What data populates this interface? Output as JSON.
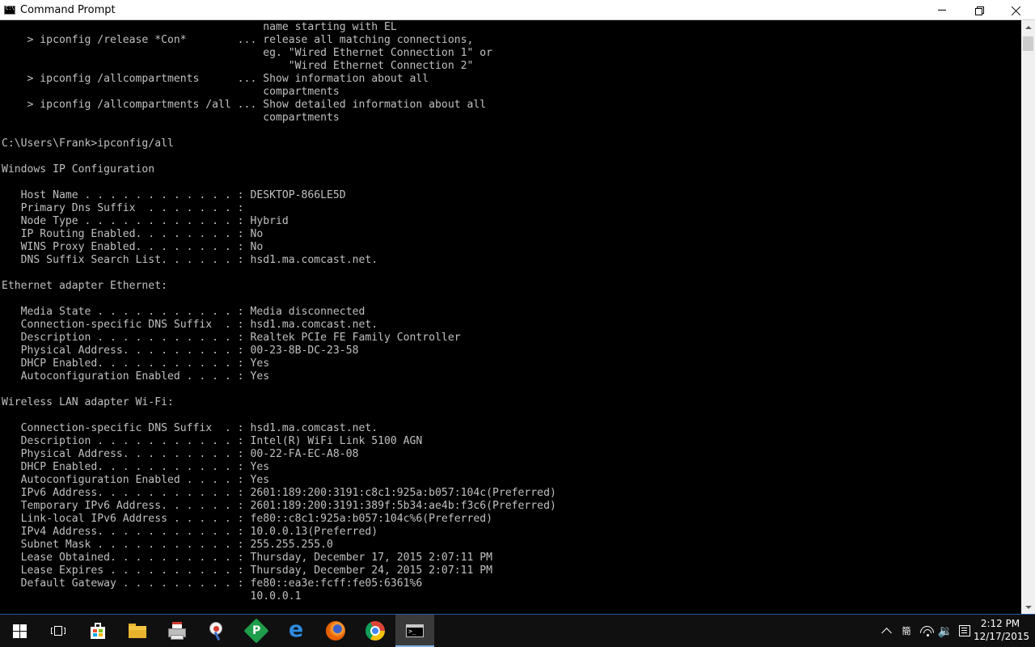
{
  "window": {
    "title": "Command Prompt",
    "minimize_icon": "minimize-icon",
    "maximize_icon": "restore-icon",
    "close_icon": "close-icon"
  },
  "console": {
    "text_color": "#c0c0c0",
    "background": "#000000",
    "lines": [
      "                                         name starting with EL",
      "    > ipconfig /release *Con*        ... release all matching connections,",
      "                                         eg. \"Wired Ethernet Connection 1\" or",
      "                                             \"Wired Ethernet Connection 2\"",
      "    > ipconfig /allcompartments      ... Show information about all",
      "                                         compartments",
      "    > ipconfig /allcompartments /all ... Show detailed information about all",
      "                                         compartments",
      "",
      "C:\\Users\\Frank>ipconfig/all",
      "",
      "Windows IP Configuration",
      "",
      "   Host Name . . . . . . . . . . . . : DESKTOP-866LE5D",
      "   Primary Dns Suffix  . . . . . . . :",
      "   Node Type . . . . . . . . . . . . : Hybrid",
      "   IP Routing Enabled. . . . . . . . : No",
      "   WINS Proxy Enabled. . . . . . . . : No",
      "   DNS Suffix Search List. . . . . . : hsd1.ma.comcast.net.",
      "",
      "Ethernet adapter Ethernet:",
      "",
      "   Media State . . . . . . . . . . . : Media disconnected",
      "   Connection-specific DNS Suffix  . : hsd1.ma.comcast.net.",
      "   Description . . . . . . . . . . . : Realtek PCIe FE Family Controller",
      "   Physical Address. . . . . . . . . : 00-23-8B-DC-23-58",
      "   DHCP Enabled. . . . . . . . . . . : Yes",
      "   Autoconfiguration Enabled . . . . : Yes",
      "",
      "Wireless LAN adapter Wi-Fi:",
      "",
      "   Connection-specific DNS Suffix  . : hsd1.ma.comcast.net.",
      "   Description . . . . . . . . . . . : Intel(R) WiFi Link 5100 AGN",
      "   Physical Address. . . . . . . . . : 00-22-FA-EC-A8-08",
      "   DHCP Enabled. . . . . . . . . . . : Yes",
      "   Autoconfiguration Enabled . . . . : Yes",
      "   IPv6 Address. . . . . . . . . . . : 2601:189:200:3191:c8c1:925a:b057:104c(Preferred)",
      "   Temporary IPv6 Address. . . . . . : 2601:189:200:3191:389f:5b34:ae4b:f3c6(Preferred)",
      "   Link-local IPv6 Address . . . . . : fe80::c8c1:925a:b057:104c%6(Preferred)",
      "   IPv4 Address. . . . . . . . . . . : 10.0.0.13(Preferred)",
      "   Subnet Mask . . . . . . . . . . . : 255.255.255.0",
      "   Lease Obtained. . . . . . . . . . : Thursday, December 17, 2015 2:07:11 PM",
      "   Lease Expires . . . . . . . . . . : Thursday, December 24, 2015 2:07:11 PM",
      "   Default Gateway . . . . . . . . . : fe80::ea3e:fcff:fe05:6361%6",
      "                                       10.0.0.1"
    ]
  },
  "scrollbar": {
    "up_icon": "scroll-up-arrow-icon",
    "down_icon": "scroll-down-arrow-icon"
  },
  "taskbar": {
    "accent": "#2a5aa8",
    "items": [
      {
        "name": "start-button",
        "icon": "windows-logo-icon"
      },
      {
        "name": "task-view-button",
        "icon": "task-view-icon"
      },
      {
        "name": "store-button",
        "icon": "store-bag-icon"
      },
      {
        "name": "file-explorer-button",
        "icon": "folder-icon"
      },
      {
        "name": "printer-app-button",
        "icon": "printer-icon"
      },
      {
        "name": "snipping-tool-button",
        "icon": "snipping-tool-icon"
      },
      {
        "name": "pdf-app-button",
        "icon": "green-p-icon",
        "glyph": "P"
      },
      {
        "name": "edge-button",
        "icon": "edge-icon",
        "glyph": "e"
      },
      {
        "name": "firefox-button",
        "icon": "firefox-icon"
      },
      {
        "name": "chrome-button",
        "icon": "chrome-icon"
      },
      {
        "name": "command-prompt-taskbar-button",
        "icon": "cmd-icon",
        "active": true
      }
    ],
    "tray": {
      "lang_glyph": "簡",
      "volume_glyph": "🔉",
      "time": "2:12 PM",
      "date": "12/17/2015"
    }
  }
}
